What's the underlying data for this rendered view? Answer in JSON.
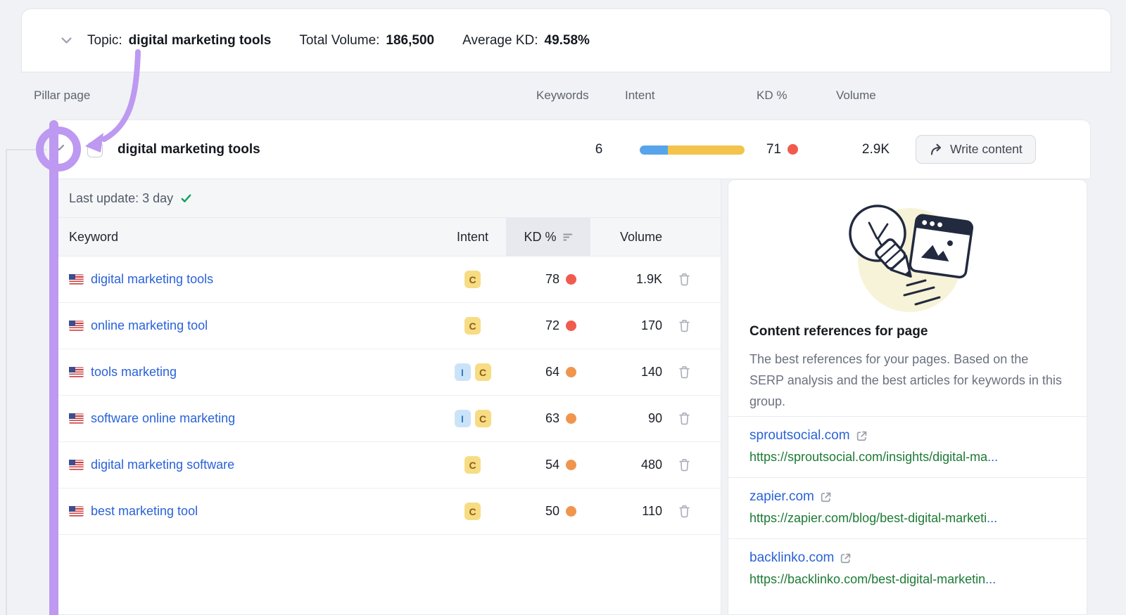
{
  "topic_bar": {
    "label": "Topic:",
    "topic": "digital marketing tools",
    "total_volume_label": "Total Volume:",
    "total_volume": "186,500",
    "average_kd_label": "Average KD:",
    "average_kd": "49.58%"
  },
  "pillar_header": {
    "pillar_page": "Pillar page",
    "keywords": "Keywords",
    "intent": "Intent",
    "kd": "KD %",
    "volume": "Volume"
  },
  "pillar_row": {
    "title": "digital marketing tools",
    "keywords_count": "6",
    "intent_bar": {
      "informational_width": "27%",
      "commercial_width": "73%"
    },
    "kd": "71",
    "kd_level": "red",
    "volume": "2.9K",
    "write_content": "Write content"
  },
  "keyword_panel": {
    "last_update": "Last update: 3 day",
    "headers": {
      "keyword": "Keyword",
      "intent": "Intent",
      "kd": "KD %",
      "volume": "Volume"
    },
    "rows": [
      {
        "keyword": "digital marketing tools",
        "intents": [
          "C"
        ],
        "kd": "78",
        "kd_level": "red",
        "volume": "1.9K"
      },
      {
        "keyword": "online marketing tool",
        "intents": [
          "C"
        ],
        "kd": "72",
        "kd_level": "red",
        "volume": "170"
      },
      {
        "keyword": "tools marketing",
        "intents": [
          "I",
          "C"
        ],
        "kd": "64",
        "kd_level": "orange",
        "volume": "140"
      },
      {
        "keyword": "software online marketing",
        "intents": [
          "I",
          "C"
        ],
        "kd": "63",
        "kd_level": "orange",
        "volume": "90"
      },
      {
        "keyword": "digital marketing software",
        "intents": [
          "C"
        ],
        "kd": "54",
        "kd_level": "orange",
        "volume": "480"
      },
      {
        "keyword": "best marketing tool",
        "intents": [
          "C"
        ],
        "kd": "50",
        "kd_level": "orange",
        "volume": "110"
      }
    ]
  },
  "references": {
    "title": "Content references for page",
    "description": "The best references for your pages. Based on the SERP analysis and the best articles for keywords in this group.",
    "links": [
      {
        "domain": "sproutsocial.com",
        "url": "https://sproutsocial.com/insights/digital-ma",
        "truncation": "..."
      },
      {
        "domain": "zapier.com",
        "url": "https://zapier.com/blog/best-digital-marketi",
        "truncation": "..."
      },
      {
        "domain": "backlinko.com",
        "url": "https://backlinko.com/best-digital-marketin",
        "truncation": "..."
      }
    ]
  },
  "colors": {
    "annotation_purple": "#bd99f1",
    "link_blue": "#2a62d8",
    "url_green": "#1d7a35",
    "kd_red": "#f15b4f",
    "kd_orange": "#f0954e",
    "intent_informational_blue": "#58a4ea",
    "intent_commercial_yellow": "#f3c44c",
    "badge_commercial_bg": "#f7dc84",
    "badge_informational_bg": "#cbe3f8",
    "check_green": "#0fa05e"
  }
}
